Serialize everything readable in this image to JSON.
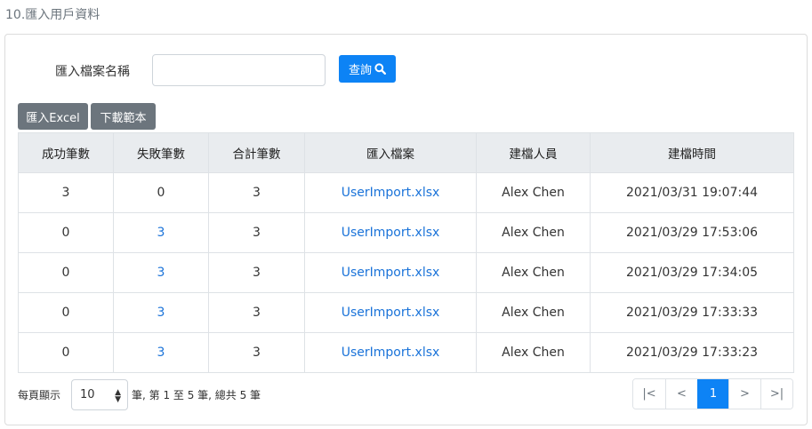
{
  "page": {
    "title": "10.匯入用戶資料"
  },
  "search": {
    "label": "匯入檔案名稱",
    "value": "",
    "placeholder": "",
    "query_label": "查詢"
  },
  "toolbar": {
    "import_label": "匯入Excel",
    "template_label": "下載範本"
  },
  "table": {
    "headers": [
      "成功筆數",
      "失敗筆數",
      "合計筆數",
      "匯入檔案",
      "建檔人員",
      "建檔時間"
    ],
    "rows": [
      {
        "success": "3",
        "fail": "0",
        "total": "3",
        "file": "UserImport.xlsx",
        "creator": "Alex Chen",
        "time": "2021/03/31 19:07:44",
        "fail_is_link": false
      },
      {
        "success": "0",
        "fail": "3",
        "total": "3",
        "file": "UserImport.xlsx",
        "creator": "Alex Chen",
        "time": "2021/03/29 17:53:06",
        "fail_is_link": true
      },
      {
        "success": "0",
        "fail": "3",
        "total": "3",
        "file": "UserImport.xlsx",
        "creator": "Alex Chen",
        "time": "2021/03/29 17:34:05",
        "fail_is_link": true
      },
      {
        "success": "0",
        "fail": "3",
        "total": "3",
        "file": "UserImport.xlsx",
        "creator": "Alex Chen",
        "time": "2021/03/29 17:33:33",
        "fail_is_link": true
      },
      {
        "success": "0",
        "fail": "3",
        "total": "3",
        "file": "UserImport.xlsx",
        "creator": "Alex Chen",
        "time": "2021/03/29 17:33:23",
        "fail_is_link": true
      }
    ]
  },
  "footer": {
    "per_page_label": "每頁顯示",
    "page_size": "10",
    "summary": "筆, 第 1 至 5 筆, 總共 5 筆"
  },
  "pagination": {
    "first": "|<",
    "prev": "<",
    "current": "1",
    "next": ">",
    "last": ">|"
  },
  "colors": {
    "primary": "#0d83f5",
    "secondary": "#6c757d",
    "link": "#1a73d9",
    "header_bg": "#e9ecef"
  },
  "icons": {
    "query": "search-icon",
    "page_size": "sort-arrows-icon"
  }
}
